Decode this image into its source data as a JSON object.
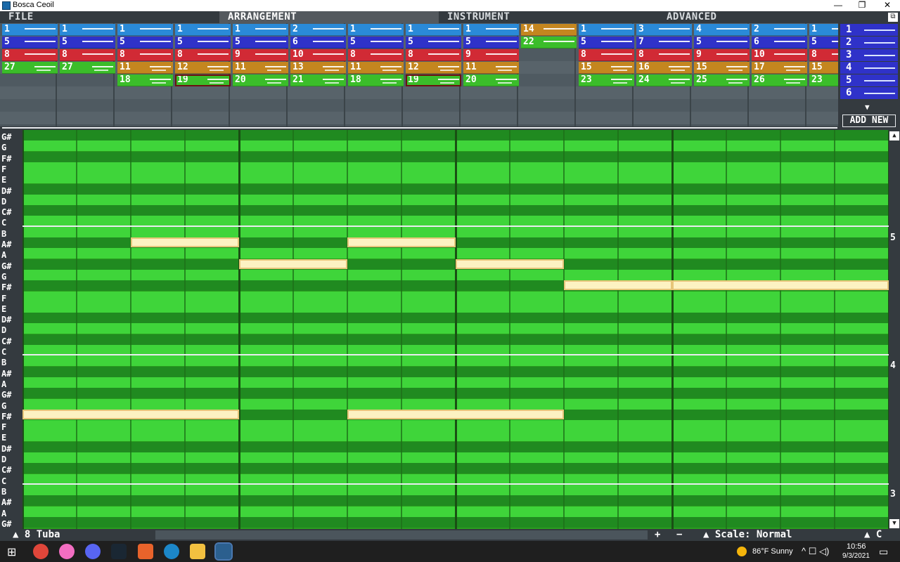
{
  "window": {
    "title": "Bosca Ceoil",
    "minimize": "—",
    "restore": "❐",
    "close": "✕"
  },
  "menu": {
    "tabs": [
      "FILE",
      "ARRANGEMENT",
      "INSTRUMENT",
      "ADVANCED"
    ],
    "active_tab": "ARRANGEMENT"
  },
  "arrangement": {
    "rows": [
      [
        "1",
        "1",
        "1",
        "1",
        "1",
        "2",
        "1",
        "1",
        "1",
        "14",
        "1",
        "3",
        "4",
        "2",
        "1"
      ],
      [
        "5",
        "5",
        "5",
        "5",
        "5",
        "6",
        "5",
        "5",
        "5",
        "22",
        "5",
        "7",
        "5",
        "6",
        "5"
      ],
      [
        "8",
        "8",
        "8",
        "8",
        "9",
        "10",
        "8",
        "8",
        "9",
        "",
        "8",
        "8",
        "9",
        "10",
        "8"
      ],
      [
        "27",
        "27",
        "11",
        "12",
        "11",
        "13",
        "11",
        "12",
        "11",
        "",
        "15",
        "16",
        "15",
        "17",
        "15"
      ],
      [
        "",
        "",
        "18",
        "19",
        "20",
        "21",
        "18",
        "19",
        "20",
        "",
        "23",
        "24",
        "25",
        "26",
        "23"
      ]
    ],
    "colors": {
      "row0": "#2a8ad8",
      "row1": "#2f32c9",
      "row2": "#d12a35",
      "row3": "#c4861f",
      "row4": "#3bbd2a",
      "row3_col0": "#3bbd2a"
    }
  },
  "pattern_list": {
    "items": [
      "1",
      "2",
      "3",
      "4",
      "5",
      "6"
    ],
    "scroll_down": "▼",
    "add_new": "ADD NEW"
  },
  "piano_roll": {
    "octave_labels": [
      "5",
      "4",
      "3"
    ],
    "scroll_up": "▲",
    "scroll_down": "▼",
    "keys": [
      "G#",
      "G",
      "F#",
      "F",
      "E",
      "D#",
      "D",
      "C#",
      "C",
      "B",
      "A#",
      "A",
      "G#",
      "G",
      "F#",
      "F",
      "E",
      "D#",
      "D",
      "C#",
      "C",
      "B",
      "A#",
      "A",
      "G#",
      "G",
      "F#",
      "F",
      "E",
      "D#",
      "D",
      "C#",
      "C",
      "B",
      "A#",
      "A",
      "G#"
    ]
  },
  "bottom_bar": {
    "instrument": "▲ 8  Tuba",
    "plus": "+",
    "minus": "−",
    "scale": "▲ Scale: Normal",
    "key": "▲ C"
  },
  "taskbar": {
    "weather": "86°F  Sunny",
    "time": "10:56",
    "date": "9/3/2021"
  }
}
